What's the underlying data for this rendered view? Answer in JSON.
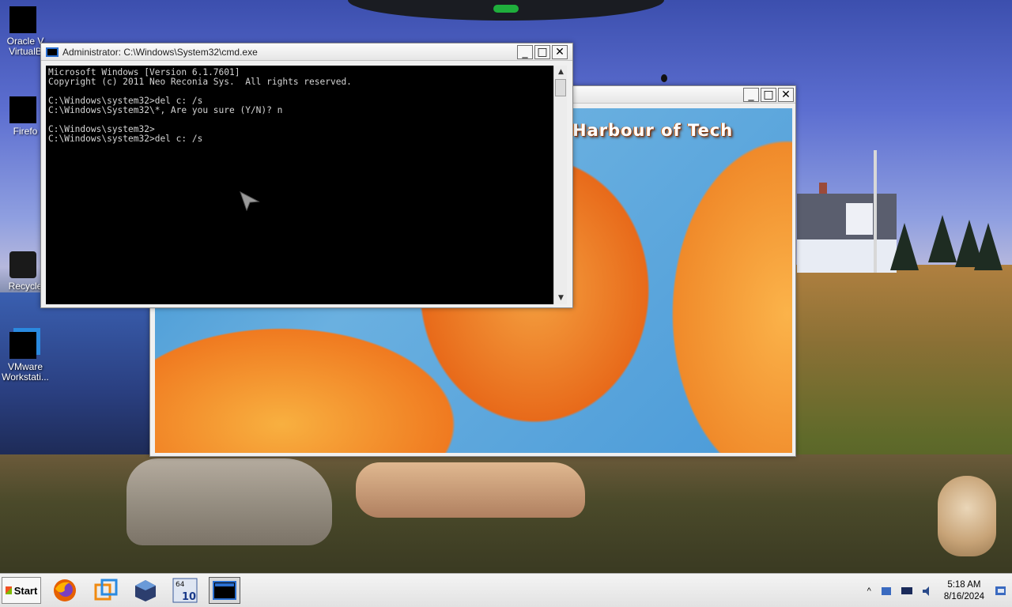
{
  "desktop": {
    "icons": [
      {
        "label": "Oracle VM VirtualBox",
        "short1": "Oracle V",
        "short2": "VirtualB"
      },
      {
        "label": "Firefox",
        "short1": "Firefo"
      },
      {
        "label": "Recycle Bin",
        "short1": "Recycle"
      },
      {
        "label": "VMware Workstation",
        "short1": "VMware",
        "short2": "Workstati..."
      }
    ]
  },
  "cmd_window": {
    "title": "Administrator: C:\\Windows\\System32\\cmd.exe",
    "lines": [
      "Microsoft Windows [Version 6.1.7601]",
      "Copyright (c) 2011 Neo Reconia Sys.  All rights reserved.",
      "",
      "C:\\Windows\\system32>del c: /s",
      "C:\\Windows\\System32\\*, Are you sure (Y/N)? n",
      "",
      "C:\\Windows\\system32>",
      "C:\\Windows\\system32>del c: /s"
    ]
  },
  "image_window": {
    "banner_text": "Harbour of Tech"
  },
  "taskbar": {
    "start_label": "Start",
    "apps": [
      "firefox-icon",
      "vmware-icon",
      "virtualbox-icon",
      "windows-10-icon",
      "cmd-icon"
    ],
    "windows10_badge": "10",
    "windows10_top": "64",
    "clock_time": "5:18 AM",
    "clock_date": "8/16/2024",
    "tray_arrow": "^"
  },
  "window_controls": {
    "minimize": "_",
    "maximize": "□",
    "close": "✕"
  },
  "colors": {
    "console_bg": "#000000",
    "console_fg": "#d4d4d4",
    "accent": "#2a6fd0"
  }
}
